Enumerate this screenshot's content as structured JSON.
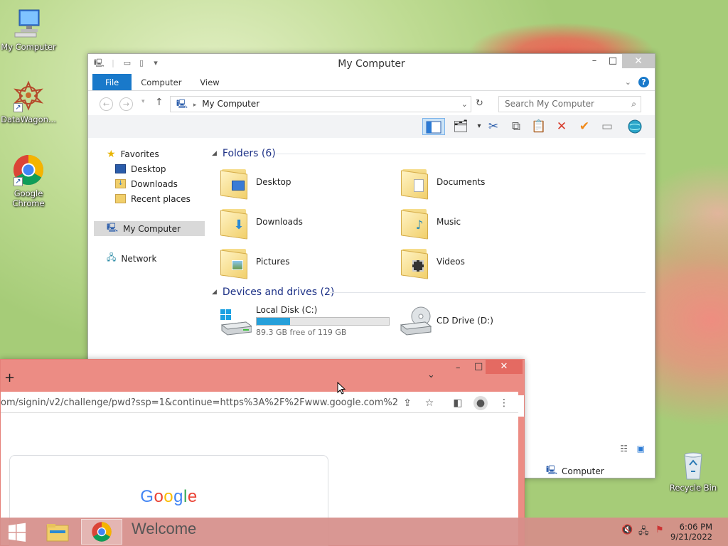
{
  "desktop": {
    "icons": [
      {
        "label": "My Computer"
      },
      {
        "label": "DataWagon..."
      },
      {
        "label": "Google Chrome"
      },
      {
        "label": "Recycle Bin"
      }
    ]
  },
  "explorer": {
    "title": "My Computer",
    "ribbon_tabs": [
      "File",
      "Computer",
      "View"
    ],
    "address": "My Computer",
    "search_placeholder": "Search My Computer",
    "nav": {
      "favorites": "Favorites",
      "favorites_items": [
        "Desktop",
        "Downloads",
        "Recent places"
      ],
      "computer": "My Computer",
      "network": "Network"
    },
    "folders_header": "Folders (6)",
    "folders": [
      "Desktop",
      "Documents",
      "Downloads",
      "Music",
      "Pictures",
      "Videos"
    ],
    "devices_header": "Devices and drives (2)",
    "drives": [
      {
        "name": "Local Disk (C:)",
        "free": "89.3 GB free of 119 GB",
        "used_fraction": 0.25
      },
      {
        "name": "CD Drive (D:)"
      }
    ],
    "status_item": "Computer"
  },
  "chrome": {
    "url": "om/signin/v2/challenge/pwd?ssp=1&continue=https%3A%2F%2Fwww.google.com%2F...",
    "new_tab": "+",
    "logo": "Google"
  },
  "taskbar": {
    "active_title": "Welcome",
    "time": "6:06 PM",
    "date": "9/21/2022"
  },
  "colors": {
    "accent": "#1979ca",
    "chrome_frame": "#ec8c84",
    "progress": "#26a0da"
  }
}
